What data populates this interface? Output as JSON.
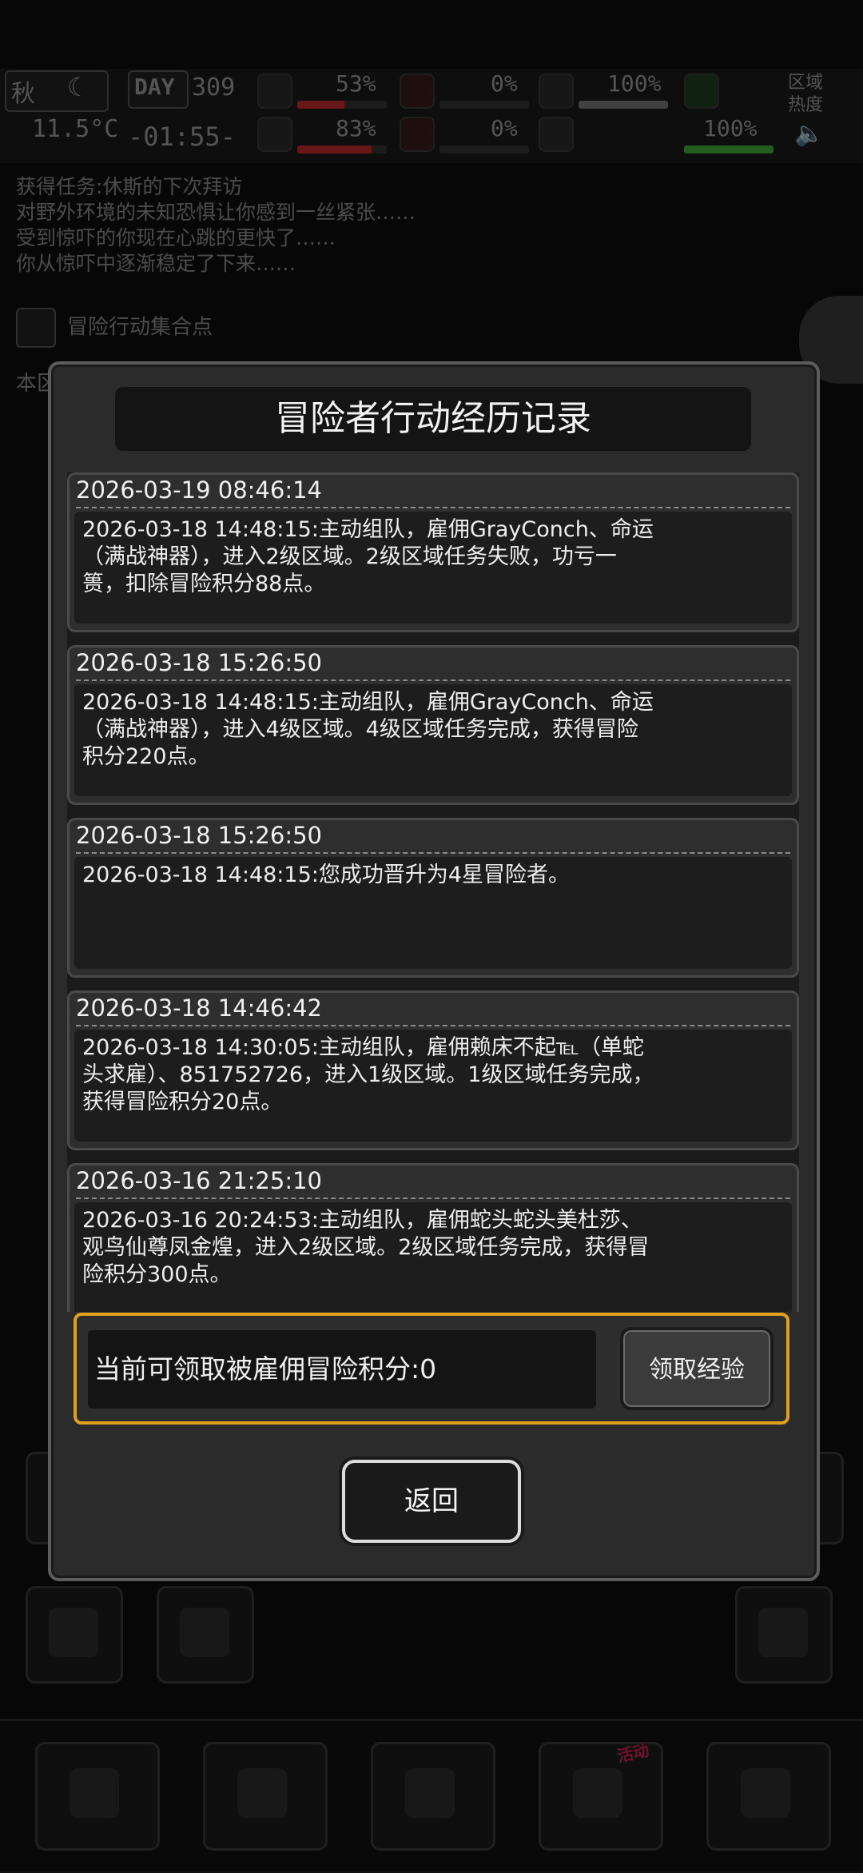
{
  "hud": {
    "season": "秋",
    "day_label": "DAY",
    "day": "309",
    "temperature": "11.5°C",
    "time": "-01:55-",
    "stat1": "53%",
    "stat2": "83%",
    "stat3": "0%",
    "stat4": "0%",
    "stat5": "100%",
    "stat6": "100%",
    "region_heat_label": "区域\n热度"
  },
  "background_log": [
    "获得任务:休斯的下次拜访",
    "对野外环境的未知恐惧让你感到一丝紧张……",
    "受到惊吓的你现在心跳的更快了……",
    "你从惊吓中逐渐稳定了下来……"
  ],
  "location": {
    "name": "冒险行动集合点",
    "below": "本区"
  },
  "dialog": {
    "title": "冒险者行动经历记录",
    "entries": [
      {
        "date": "2026-03-19 08:46:14",
        "text": "2026-03-18 14:48:15:主动组队，雇佣GrayConch、命运（满战神器），进入2级区域。2级区域任务失败，功亏一篑，扣除冒险积分88点。"
      },
      {
        "date": "2026-03-18 15:26:50",
        "text": "2026-03-18 14:48:15:主动组队，雇佣GrayConch、命运（满战神器），进入4级区域。4级区域任务完成，获得冒险积分220点。"
      },
      {
        "date": "2026-03-18 15:26:50",
        "text": "2026-03-18 14:48:15:您成功晋升为4星冒险者。"
      },
      {
        "date": "2026-03-18 14:46:42",
        "text": "2026-03-18 14:30:05:主动组队，雇佣赖床不起℡（单蛇头求雇）、851752726，进入1级区域。1级区域任务完成，获得冒险积分20点。"
      },
      {
        "date": "2026-03-16 21:25:10",
        "text": "2026-03-16 20:24:53:主动组队，雇佣蛇头蛇头美杜莎、观鸟仙尊凤金煌，进入2级区域。2级区域任务完成，获得冒险积分300点。"
      }
    ],
    "claim_text": "当前可领取被雇佣冒险积分:0",
    "claim_button": "领取经验",
    "back_button": "返回"
  },
  "colors": {
    "accent": "#e0a11b",
    "red": "#c0282d",
    "green": "#3fa83a"
  },
  "bottom_badge": "活动"
}
